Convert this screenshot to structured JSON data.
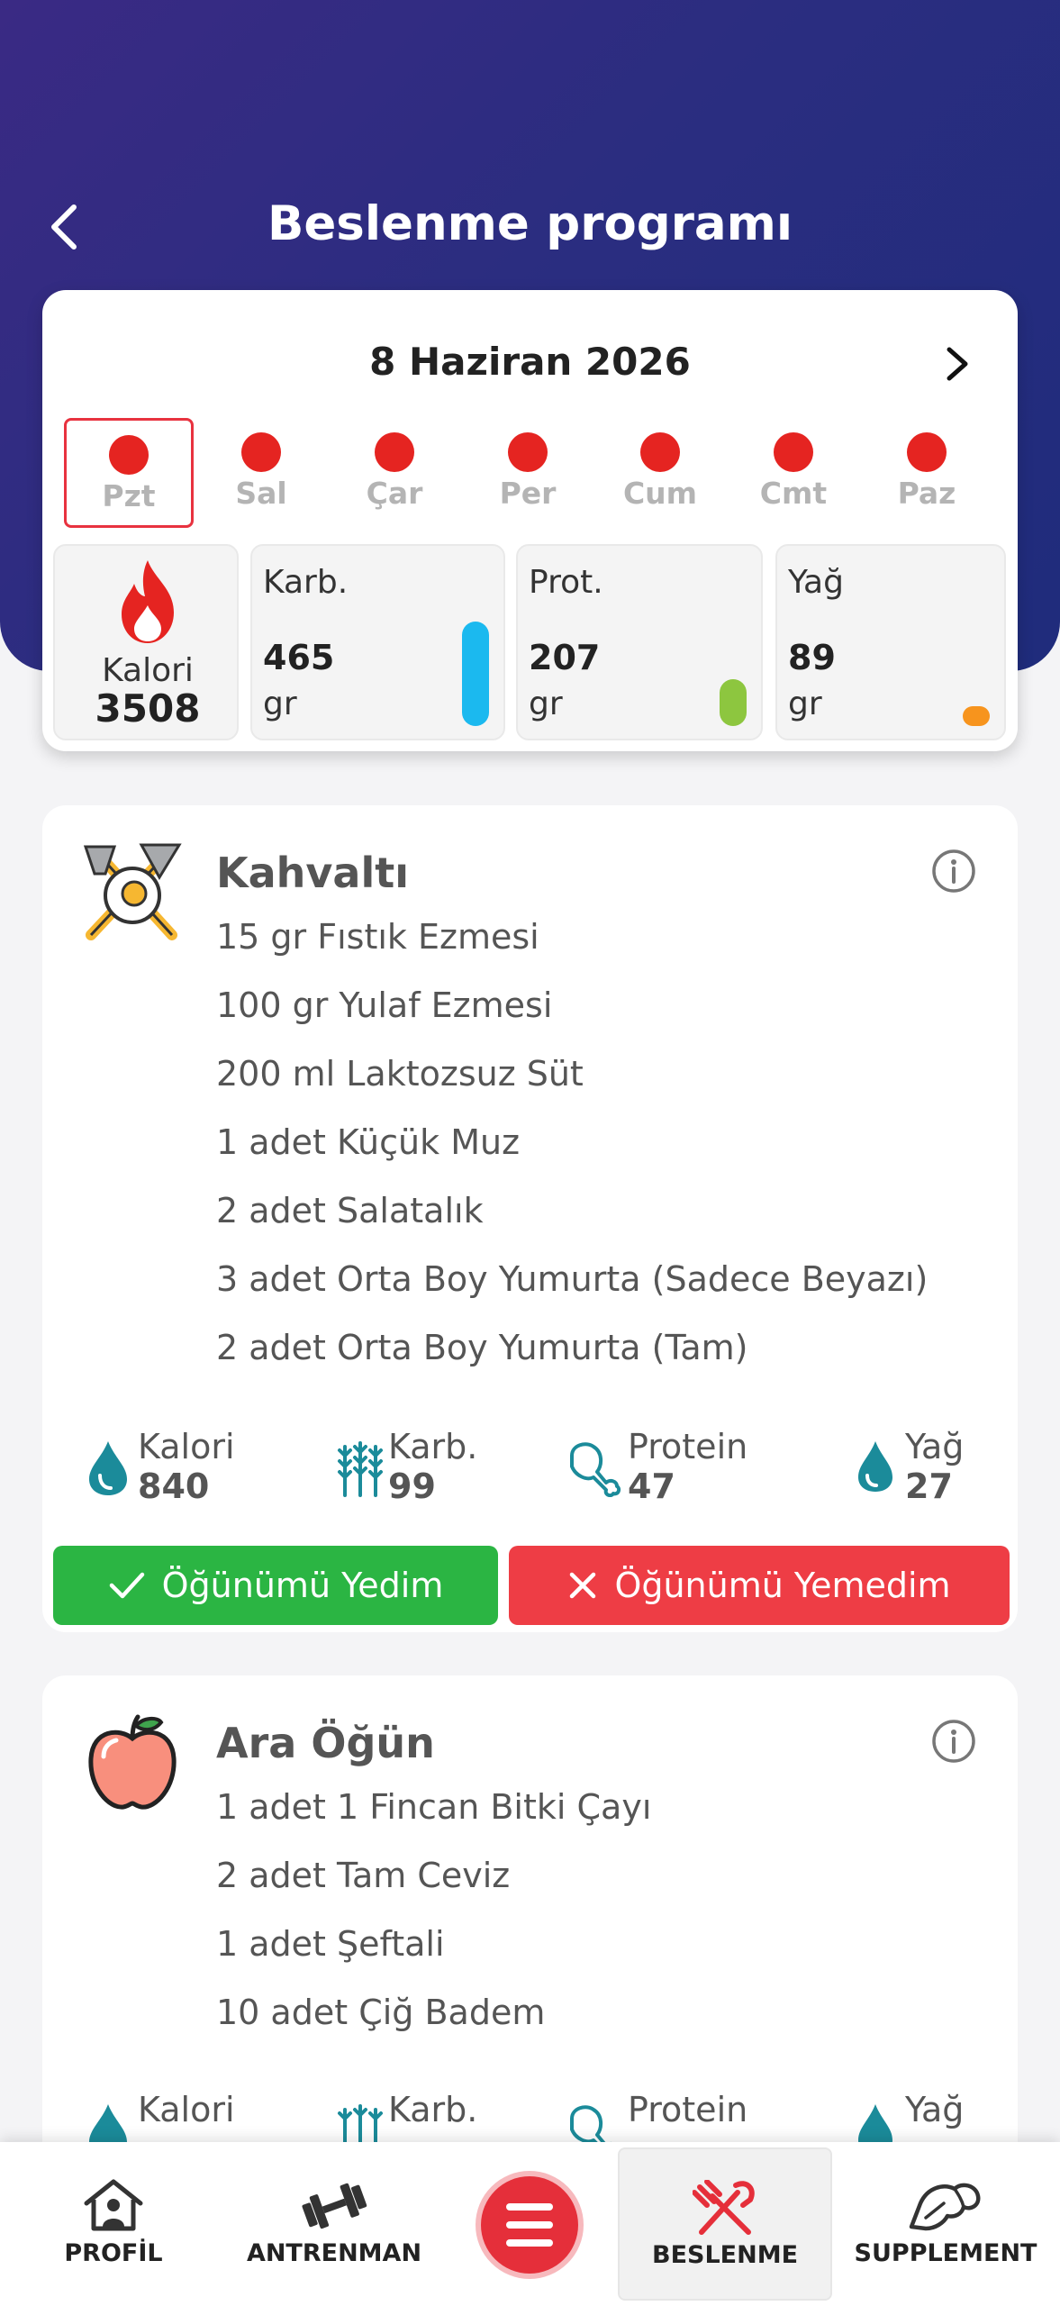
{
  "header": {
    "title": "Beslenme programı",
    "back_icon": "chevron-left-icon"
  },
  "summary": {
    "date": "8 Haziran 2026",
    "next_icon": "chevron-right-icon",
    "days": [
      {
        "label": "Pzt",
        "selected": true
      },
      {
        "label": "Sal"
      },
      {
        "label": "Çar"
      },
      {
        "label": "Per"
      },
      {
        "label": "Cum"
      },
      {
        "label": "Cmt"
      },
      {
        "label": "Paz"
      }
    ],
    "calorie": {
      "label": "Kalori",
      "value": "3508",
      "icon": "flame-icon"
    },
    "macros": [
      {
        "title": "Karb.",
        "value": "465",
        "unit": "gr",
        "color": "#1bb9ef"
      },
      {
        "title": "Prot.",
        "value": "207",
        "unit": "gr",
        "color": "#8dc63f"
      },
      {
        "title": "Yağ",
        "value": "89",
        "unit": "gr",
        "color": "#f7941d"
      }
    ]
  },
  "meals": [
    {
      "title": "Kahvaltı",
      "icon": "fried-egg-cutlery-icon",
      "foods": [
        "15 gr Fıstık Ezmesi",
        "100 gr Yulaf Ezmesi",
        "200 ml Laktozsuz Süt",
        "1 adet Küçük Muz",
        "2 adet Salatalık",
        "3 adet Orta Boy Yumurta (Sadece Beyazı)",
        "2 adet Orta Boy Yumurta (Tam)"
      ],
      "stats": [
        {
          "label": "Kalori",
          "value": "840",
          "icon": "calorie-drop-icon"
        },
        {
          "label": "Karb.",
          "value": "99",
          "icon": "wheat-icon"
        },
        {
          "label": "Protein",
          "value": "47",
          "icon": "drumstick-icon"
        },
        {
          "label": "Yağ",
          "value": "27",
          "icon": "oil-drop-icon"
        }
      ],
      "ate_label": "Öğünümü Yedim",
      "not_ate_label": "Öğünümü Yemedim"
    },
    {
      "title": "Ara Öğün",
      "icon": "apple-icon",
      "foods": [
        "1 adet 1 Fincan Bitki Çayı",
        "2 adet Tam Ceviz",
        "1 adet Şeftali",
        "10 adet Çiğ Badem"
      ],
      "stats": [
        {
          "label": "Kalori",
          "icon": "calorie-drop-icon"
        },
        {
          "label": "Karb.",
          "icon": "wheat-icon"
        },
        {
          "label": "Protein",
          "icon": "drumstick-icon"
        },
        {
          "label": "Yağ",
          "icon": "oil-drop-icon"
        }
      ]
    }
  ],
  "bottom_nav": [
    {
      "label": "PROFİL",
      "icon": "home-user-icon"
    },
    {
      "label": "ANTRENMAN",
      "icon": "dumbbell-icon"
    },
    {
      "label": "",
      "icon": "menu-icon"
    },
    {
      "label": "BESLENME",
      "icon": "fork-knife-icon",
      "active": true
    },
    {
      "label": "SUPPLEMENT",
      "icon": "arm-muscle-icon"
    }
  ],
  "colors": {
    "accent_red": "#e52421",
    "success_green": "#2bb543",
    "danger_red": "#ee3d45",
    "header_gradient_start": "#3a2a84",
    "header_gradient_end": "#1f2c7c"
  }
}
